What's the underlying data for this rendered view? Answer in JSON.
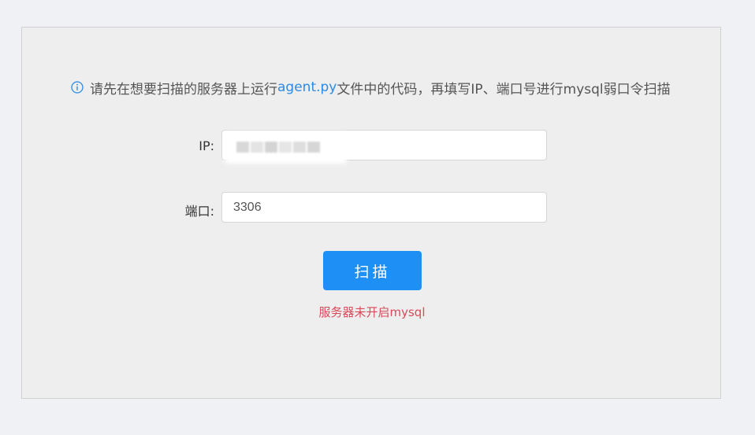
{
  "hint": {
    "icon": "info-icon",
    "prefix": "请先在想要扫描的服务器上运行",
    "link_text": "agent.py",
    "suffix": "文件中的代码，再填写IP、端口号进行mysql弱口令扫描"
  },
  "form": {
    "ip_label": "IP:",
    "ip_value": "",
    "port_label": "端口:",
    "port_value": "3306"
  },
  "scan_button": {
    "label": "扫描"
  },
  "status": {
    "error_message": "服务器未开启mysql"
  },
  "colors": {
    "accent": "#1e8ff5",
    "link": "#2a8ae6",
    "error": "#d84a5a",
    "panel_bg": "#eeeeee",
    "page_bg": "#f0f1f5"
  }
}
